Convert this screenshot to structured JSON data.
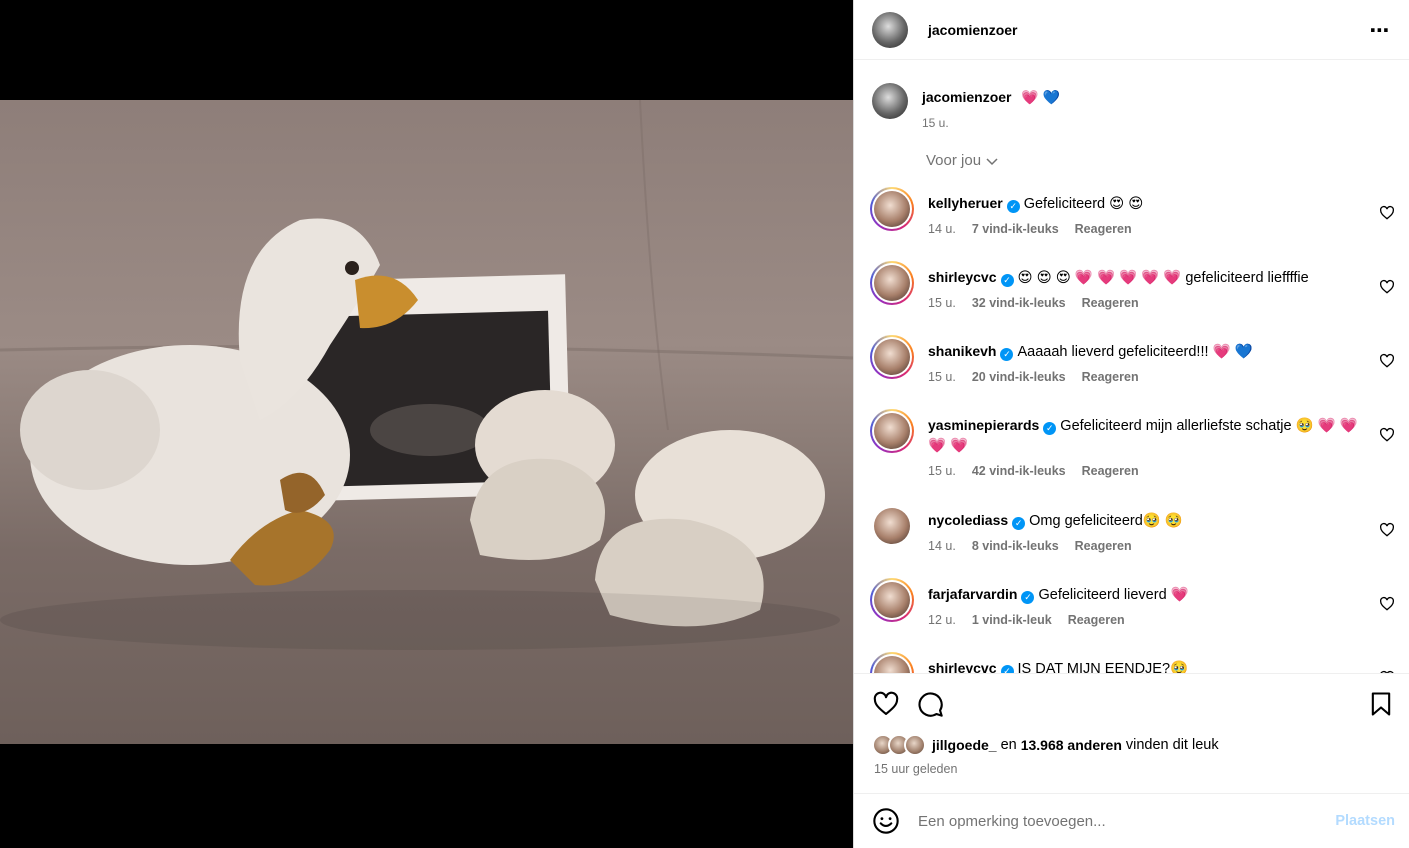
{
  "post": {
    "author": "jacomienzoer",
    "caption_text": "💗 💙",
    "caption_time": "15 u.",
    "filter_label": "Voor jou",
    "image_description_icon": "photo-plush-goose-ultrasound-booties"
  },
  "comments": [
    {
      "user": "kellyheruer",
      "verified": true,
      "text": "Gefeliciteerd 😍 😍",
      "time": "14 u.",
      "likes": "7 vind-ik-leuks",
      "reply": "Reageren"
    },
    {
      "user": "shirleycvc",
      "verified": true,
      "text": "😍 😍 😍 💗 💗 💗 💗 💗  gefeliciteerd lieffffie",
      "time": "15 u.",
      "likes": "32 vind-ik-leuks",
      "reply": "Reageren"
    },
    {
      "user": "shanikevh",
      "verified": true,
      "text": "Aaaaah lieverd gefeliciteerd!!! 💗 💙",
      "time": "15 u.",
      "likes": "20 vind-ik-leuks",
      "reply": "Reageren"
    },
    {
      "user": "yasminepierards",
      "verified": true,
      "text": "Gefeliciteerd mijn allerliefste schatje 🥹 💗 💗 💗 💗",
      "time": "15 u.",
      "likes": "42 vind-ik-leuks",
      "reply": "Reageren"
    },
    {
      "user": "nycolediass",
      "verified": true,
      "text": "Omg gefeliciteerd🥹 🥹",
      "time": "14 u.",
      "likes": "8 vind-ik-leuks",
      "reply": "Reageren"
    },
    {
      "user": "farjafarvardin",
      "verified": true,
      "text": "Gefeliciteerd lieverd 💗",
      "time": "12 u.",
      "likes": "1 vind-ik-leuk",
      "reply": "Reageren"
    },
    {
      "user": "shirleycvc",
      "verified": true,
      "text": "IS DAT MIJN EENDJE?🥹",
      "time": "",
      "likes": "",
      "reply": ""
    }
  ],
  "footer": {
    "liked_by_user": "jillgoede_",
    "liked_by_middle": "en",
    "liked_by_count": "13.968 anderen",
    "liked_by_suffix": "vinden dit leuk",
    "posted_ago": "15 uur geleden",
    "comment_placeholder": "Een opmerking toevoegen...",
    "post_button": "Plaatsen"
  },
  "colors": {
    "verified": "#0095f6",
    "post_disabled": "#b3dbff",
    "muted": "#737373"
  }
}
